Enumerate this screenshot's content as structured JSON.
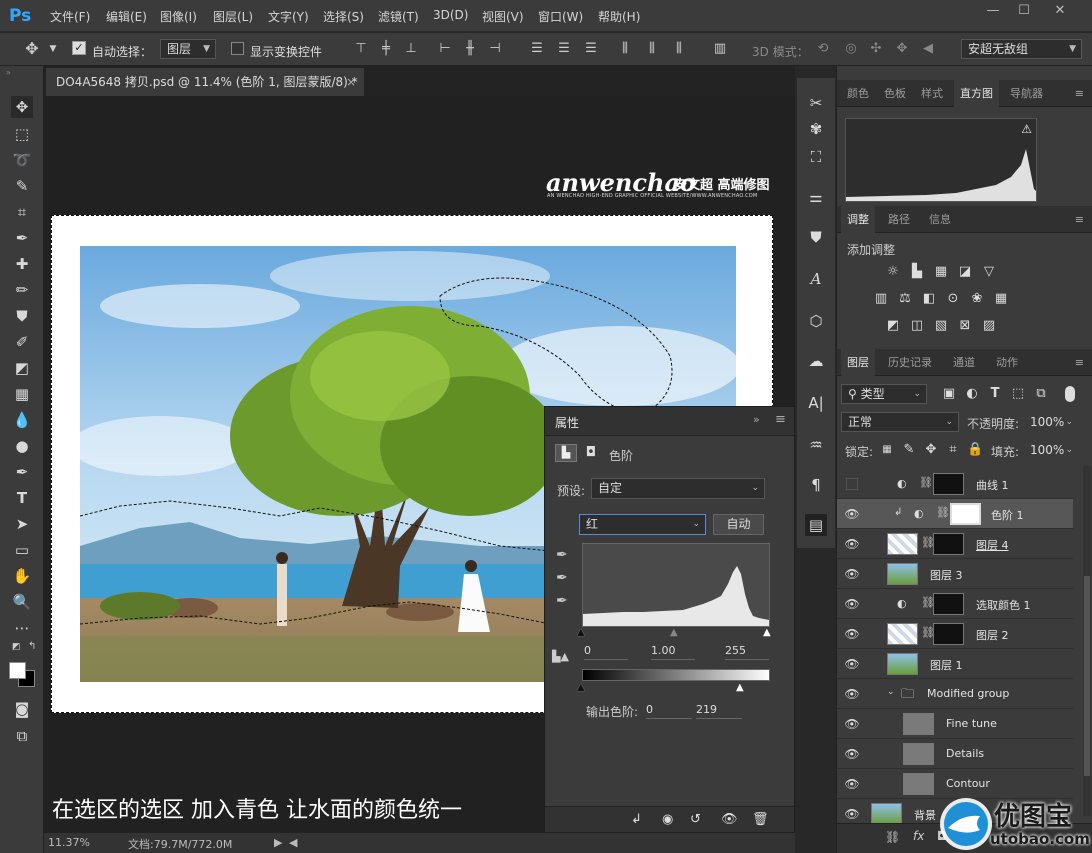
{
  "app": {
    "logo": "Ps"
  },
  "menu": [
    "文件(F)",
    "编辑(E)",
    "图像(I)",
    "图层(L)",
    "文字(Y)",
    "选择(S)",
    "滤镜(T)",
    "3D(D)",
    "视图(V)",
    "窗口(W)",
    "帮助(H)"
  ],
  "window_controls": {
    "minimize": "—",
    "maximize": "☐",
    "close": "✕"
  },
  "options": {
    "auto_select_label": "自动选择：",
    "auto_select_checked": true,
    "auto_select_target": "图层",
    "show_transform_label": "显示变换控件",
    "show_transform_checked": false,
    "mode_3d_label": "3D 模式：",
    "workspace": "安超无敌组"
  },
  "document": {
    "tab_title": "DO4A5648 拷贝.psd @ 11.4% (色阶 1, 图层蒙版/8) *",
    "close": "×",
    "caption": "在选区的选区  加入青色  让水面的颜色统一",
    "watermark_main": "anwenchao",
    "watermark_cn": "安文超 高端修图",
    "watermark_sub": "AN WENCHAO HIGH-END GRAPHIC OFFICIAL WEBSITE/WWW.ANWENCHAO.COM"
  },
  "status": {
    "zoom": "11.37%",
    "doc_size": "文档:79.7M/772.0M"
  },
  "properties": {
    "title": "属性",
    "adjustment_name": "色阶",
    "preset_label": "预设:",
    "preset_value": "自定",
    "channel": "红",
    "auto_button": "自动",
    "input_black": "0",
    "input_gamma": "1.00",
    "input_white": "255",
    "output_label": "输出色阶:",
    "output_black": "0",
    "output_white": "219"
  },
  "panel_top": {
    "tabs": [
      "颜色",
      "色板",
      "样式",
      "直方图",
      "导航器"
    ],
    "active": 3
  },
  "panel_adjust": {
    "tabs": [
      "调整",
      "路径",
      "信息"
    ],
    "active": 0,
    "add_label": "添加调整"
  },
  "panel_layers": {
    "tabs": [
      "图层",
      "历史记录",
      "通道",
      "动作"
    ],
    "active": 0,
    "filter_kind": "类型",
    "blend_mode": "正常",
    "opacity_label": "不透明度:",
    "opacity": "100%",
    "lock_label": "锁定:",
    "fill_label": "填充:",
    "fill": "100%",
    "layers": [
      {
        "name": "曲线 1",
        "visible": false,
        "type": "adjustment",
        "selected": false
      },
      {
        "name": "色阶 1",
        "visible": true,
        "type": "adjustment",
        "selected": true
      },
      {
        "name": "图层 4",
        "visible": true,
        "type": "pixel",
        "selected": false
      },
      {
        "name": "图层 3",
        "visible": true,
        "type": "pixel",
        "selected": false
      },
      {
        "name": "选取颜色 1",
        "visible": true,
        "type": "adjustment",
        "selected": false
      },
      {
        "name": "图层 2",
        "visible": true,
        "type": "pixel",
        "selected": false
      },
      {
        "name": "图层 1",
        "visible": true,
        "type": "pixel",
        "selected": false
      },
      {
        "name": "Modified group",
        "visible": true,
        "type": "group",
        "selected": false
      },
      {
        "name": "Fine tune",
        "visible": true,
        "type": "pixel",
        "selected": false
      },
      {
        "name": "Details",
        "visible": true,
        "type": "pixel",
        "selected": false
      },
      {
        "name": "Contour",
        "visible": true,
        "type": "pixel",
        "selected": false
      },
      {
        "name": "背景",
        "visible": true,
        "type": "pixel",
        "selected": false
      }
    ]
  },
  "site_logo": {
    "text": "优图宝",
    "url": "utobao.com"
  }
}
